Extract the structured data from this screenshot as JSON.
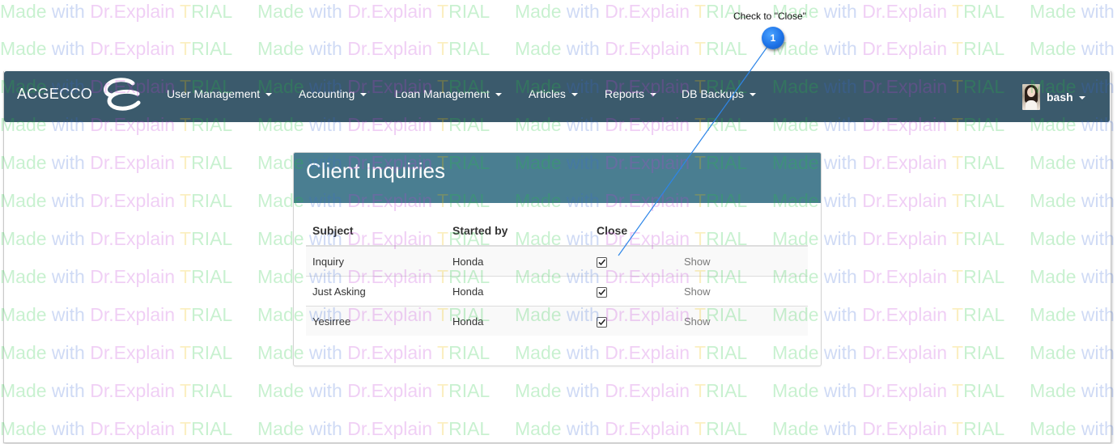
{
  "watermark": {
    "made": "Made",
    "with": " with ",
    "dr": "Dr.Explain",
    "trial_t": " T",
    "trial_rest": "RIAL"
  },
  "navbar": {
    "brand": "ACGECCO",
    "menu": [
      {
        "label": "User Management",
        "has_caret": true
      },
      {
        "label": "Accounting",
        "has_caret": true
      },
      {
        "label": "Loan Management",
        "has_caret": true
      },
      {
        "label": "Articles",
        "has_caret": true
      },
      {
        "label": "Reports",
        "has_caret": true
      },
      {
        "label": "DB Backups",
        "has_caret": true
      }
    ],
    "user": {
      "name": "bash",
      "has_caret": true
    }
  },
  "panel": {
    "title": "Client Inquiries",
    "table": {
      "headers": [
        "Subject",
        "Started by",
        "Close",
        ""
      ],
      "rows": [
        {
          "subject": "Inquiry",
          "started_by": "Honda",
          "close_checked": true,
          "action": "Show"
        },
        {
          "subject": "Just Asking",
          "started_by": "Honda",
          "close_checked": true,
          "action": "Show"
        },
        {
          "subject": "Yesirree",
          "started_by": "Honda",
          "close_checked": true,
          "action": "Show"
        }
      ]
    }
  },
  "callout": {
    "number": "1",
    "label": "Check to \"Close\""
  },
  "colors": {
    "navbar_bg": "#3b5a6c",
    "panel_heading_bg": "#4a7e91",
    "callout_blue": "#1e73e8"
  },
  "icons": {
    "brand_logo": "acgecco-logo-icon",
    "dropdown": "caret-down-icon",
    "checkbox": "checkbox-checked-icon",
    "avatar": "user-avatar-icon"
  }
}
